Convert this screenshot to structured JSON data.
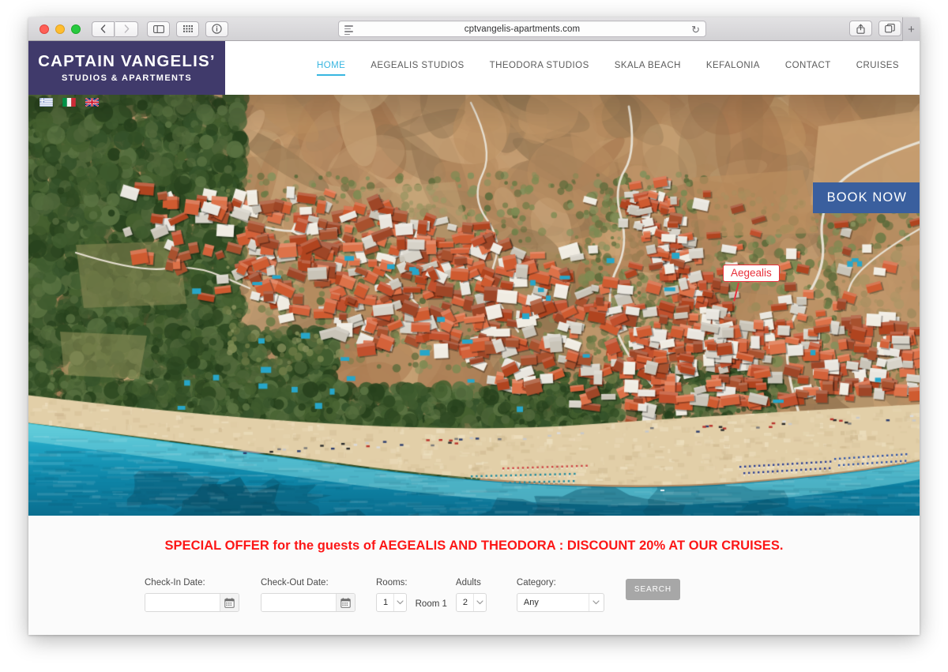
{
  "browser": {
    "url": "cptvangelis-apartments.com",
    "reload_icon": "reload-icon",
    "back_icon": "‹",
    "forward_icon": "›",
    "sidebar_icon": "sidebar-icon",
    "tabs_icon": "show-all-tabs-icon",
    "info_icon": "ⓘ",
    "share_icon": "share-icon",
    "newtab_icon": "+",
    "traffic_lights": [
      "close",
      "minimize",
      "zoom"
    ]
  },
  "site": {
    "logo": {
      "main": "CAPTAIN VANGELIS’",
      "sub": "STUDIOS & APARTMENTS"
    },
    "nav": [
      {
        "label": "HOME",
        "active": true
      },
      {
        "label": "AEGEALIS STUDIOS",
        "active": false
      },
      {
        "label": "THEODORA STUDIOS",
        "active": false
      },
      {
        "label": "SKALA BEACH",
        "active": false
      },
      {
        "label": "KEFALONIA",
        "active": false
      },
      {
        "label": "CONTACT",
        "active": false
      },
      {
        "label": "CRUISES",
        "active": false
      }
    ],
    "languages": [
      {
        "name": "greek-flag",
        "code": "GR"
      },
      {
        "name": "italian-flag",
        "code": "IT"
      },
      {
        "name": "english-flag",
        "code": "EN"
      }
    ],
    "hero": {
      "book_now": "BOOK NOW",
      "marker": "Aegealis",
      "alt": "Aerial photo of Skala beach village, Kefalonia"
    },
    "offer": "SPECIAL OFFER for the guests of AEGEALIS AND THEODORA : DISCOUNT 20% AT OUR CRUISES.",
    "booking": {
      "checkin_label": "Check-In Date:",
      "checkin_value": "",
      "checkout_label": "Check-Out Date:",
      "checkout_value": "",
      "rooms_label": "Rooms:",
      "rooms_value": "1",
      "room_badge": "Room 1",
      "adults_label": "Adults",
      "adults_value": "2",
      "category_label": "Category:",
      "category_value": "Any",
      "search_label": "SEARCH",
      "calendar_icon": "calendar-icon"
    }
  },
  "colors": {
    "logo_purple": "#403a6b",
    "nav_active": "#38b6e0",
    "offer_red": "#fc1616",
    "book_blue": "#3a5f9e",
    "marker_red": "#e8303a",
    "search_gray": "#a7a7a7"
  }
}
